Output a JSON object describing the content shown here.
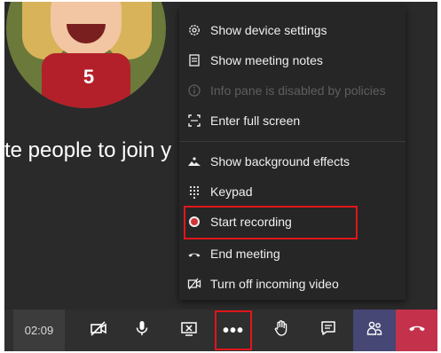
{
  "meeting": {
    "invite_text": "te people to join y",
    "avatar_number": "5"
  },
  "menu": {
    "items": [
      {
        "label": "Show device settings",
        "icon": "gear-icon"
      },
      {
        "label": "Show meeting notes",
        "icon": "notes-icon"
      },
      {
        "label": "Info pane is disabled by policies",
        "icon": "info-icon",
        "disabled": true
      },
      {
        "label": "Enter full screen",
        "icon": "fullscreen-icon"
      },
      {
        "label": "Show background effects",
        "icon": "background-effects-icon"
      },
      {
        "label": "Keypad",
        "icon": "keypad-icon"
      },
      {
        "label": "Start recording",
        "icon": "record-icon",
        "highlighted": true
      },
      {
        "label": "End meeting",
        "icon": "end-meeting-icon"
      },
      {
        "label": "Turn off incoming video",
        "icon": "video-off-icon"
      }
    ]
  },
  "toolbar": {
    "timer": "02:09",
    "colors": {
      "people": "#464775",
      "hangup": "#c4314b",
      "highlight": "#e0161b"
    }
  }
}
